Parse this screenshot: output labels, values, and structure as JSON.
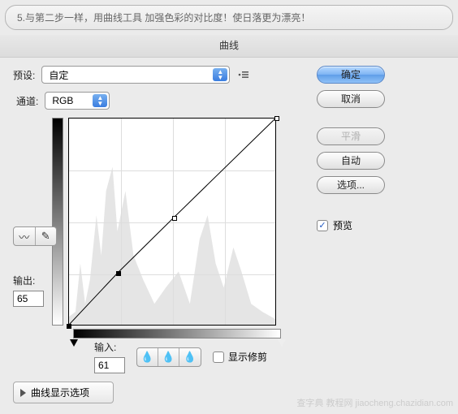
{
  "caption": "5.与第二步一样，用曲线工具 加强色彩的对比度！使日落更为漂亮！",
  "dialog": {
    "title": "曲线",
    "preset_label": "预设:",
    "preset_value": "自定",
    "channel_label": "通道:",
    "channel_value": "RGB",
    "output_label": "输出:",
    "output_value": "65",
    "input_label": "输入:",
    "input_value": "61",
    "show_clipping_label": "显示修剪",
    "disclosure_label": "曲线显示选项",
    "preview_label": "预览"
  },
  "buttons": {
    "ok": "确定",
    "cancel": "取消",
    "smooth": "平滑",
    "auto": "自动",
    "options": "选项..."
  },
  "chart_data": {
    "type": "line",
    "title": "",
    "xlabel": "输入",
    "ylabel": "输出",
    "xlim": [
      0,
      255
    ],
    "ylim": [
      0,
      255
    ],
    "series": [
      {
        "name": "curve",
        "x": [
          0,
          61,
          130,
          255
        ],
        "y": [
          0,
          65,
          133,
          255
        ]
      }
    ],
    "selected_point": {
      "x": 61,
      "y": 65
    }
  },
  "watermark": "查字典  教程网\njiaocheng.chazidian.com"
}
